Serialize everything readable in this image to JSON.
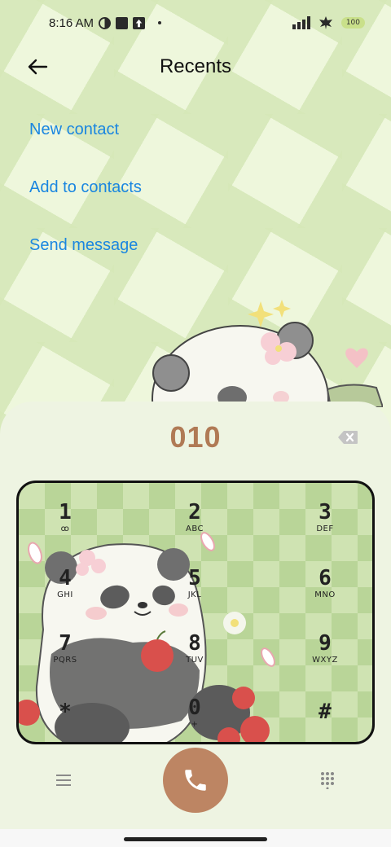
{
  "status_bar": {
    "time": "8:16 AM",
    "battery": "100",
    "icons": [
      "data-saver-icon",
      "square-notification-icon",
      "upload-icon",
      "dot-icon",
      "signal-icon",
      "leaf-icon"
    ]
  },
  "header": {
    "title": "Recents",
    "back_icon": "back-arrow-icon"
  },
  "actions": {
    "new_contact": "New contact",
    "add_to_contacts": "Add to contacts",
    "send_message": "Send message"
  },
  "dialer": {
    "number": "010",
    "backspace_icon": "backspace-icon",
    "keys": [
      {
        "digit": "1",
        "letters": "ꝏ"
      },
      {
        "digit": "2",
        "letters": "ABC"
      },
      {
        "digit": "3",
        "letters": "DEF"
      },
      {
        "digit": "4",
        "letters": "GHI"
      },
      {
        "digit": "5",
        "letters": "JKL"
      },
      {
        "digit": "6",
        "letters": "MNO"
      },
      {
        "digit": "7",
        "letters": "PQRS"
      },
      {
        "digit": "8",
        "letters": "TUV"
      },
      {
        "digit": "9",
        "letters": "WXYZ"
      },
      {
        "digit": "*",
        "letters": ""
      },
      {
        "digit": "0",
        "letters": "+"
      },
      {
        "digit": "#",
        "letters": ""
      }
    ]
  },
  "bottom_bar": {
    "menu_icon": "menu-icon",
    "call_icon": "phone-icon",
    "dialpad_icon": "dialpad-icon"
  },
  "colors": {
    "accent_link": "#1a86e0",
    "number": "#b07a55",
    "call_button": "#bd8563"
  }
}
